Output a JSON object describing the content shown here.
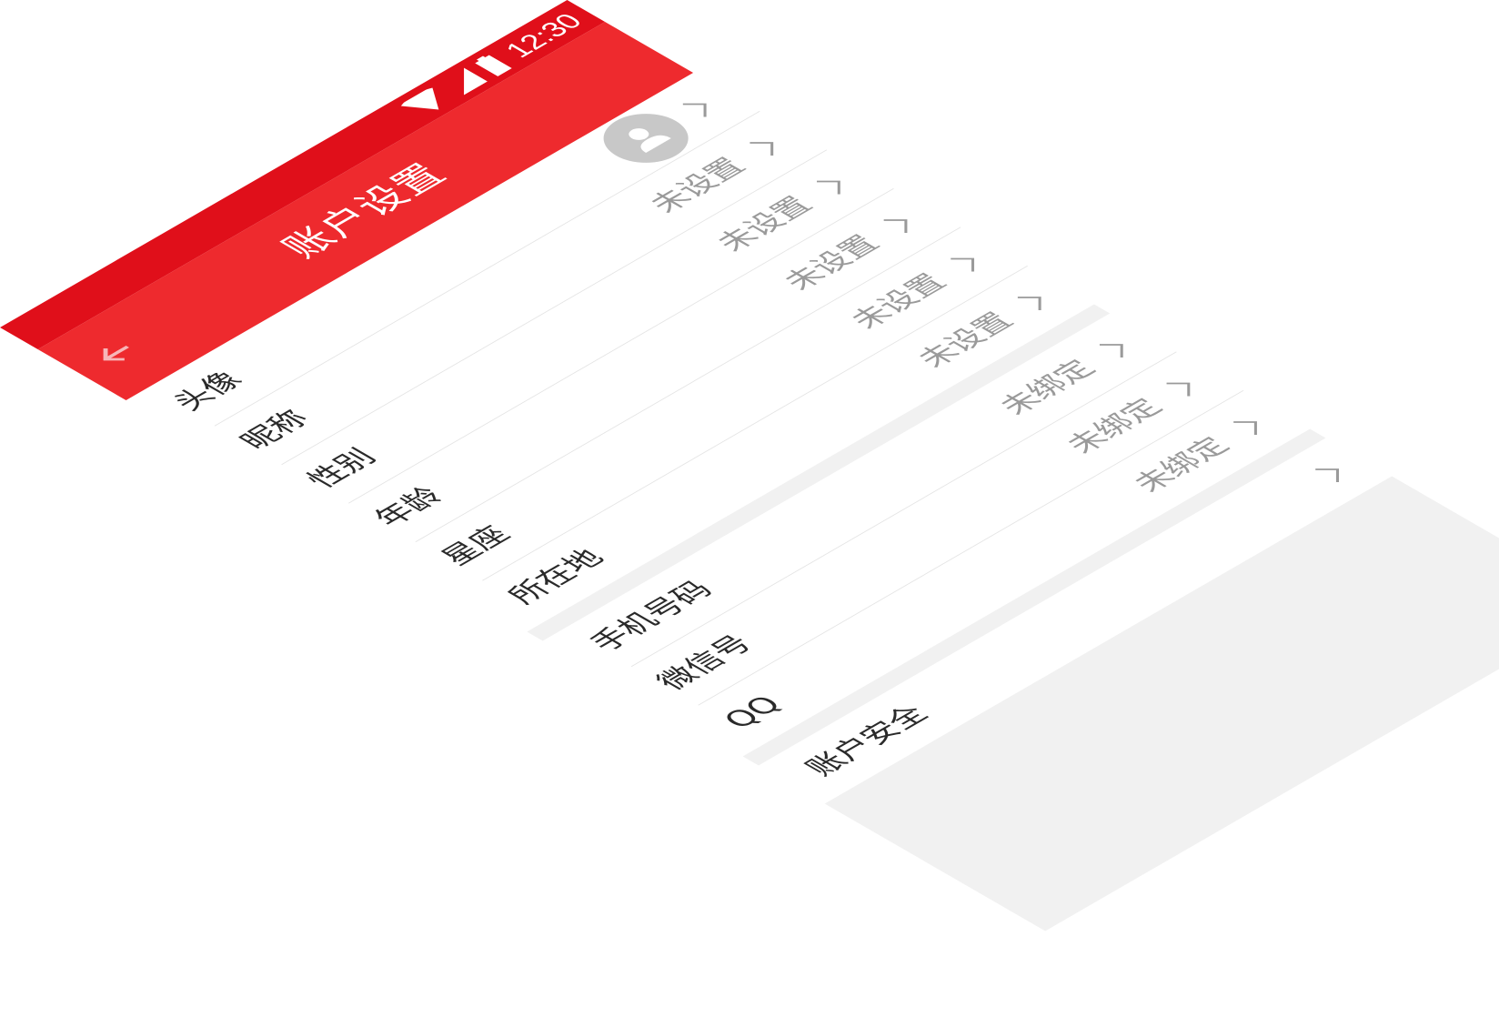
{
  "status_bar": {
    "time": "12:30",
    "icons": [
      "wifi-icon",
      "cellular-signal-icon",
      "battery-icon"
    ]
  },
  "app_bar": {
    "title": "账户设置",
    "back_icon": "back-arrow-icon"
  },
  "colors": {
    "status_bar": "#e00f1a",
    "app_bar": "#ee2a2e",
    "value_text": "#9a9a9a",
    "label_text": "#2a2a2a",
    "divider": "#e4e4e4",
    "section_gap": "#f1f1f1"
  },
  "settings": {
    "profile": [
      {
        "label": "头像",
        "avatar": "default-user-icon"
      },
      {
        "label": "昵称",
        "value": "未设置"
      },
      {
        "label": "性别",
        "value": "未设置"
      },
      {
        "label": "年龄",
        "value": "未设置"
      },
      {
        "label": "星座",
        "value": "未设置"
      },
      {
        "label": "所在地",
        "value": "未设置"
      }
    ],
    "bindings": [
      {
        "label": "手机号码",
        "value": "未绑定"
      },
      {
        "label": "微信号",
        "value": "未绑定"
      },
      {
        "label": "QQ",
        "value": "未绑定"
      }
    ],
    "security": [
      {
        "label": "账户安全"
      }
    ]
  }
}
